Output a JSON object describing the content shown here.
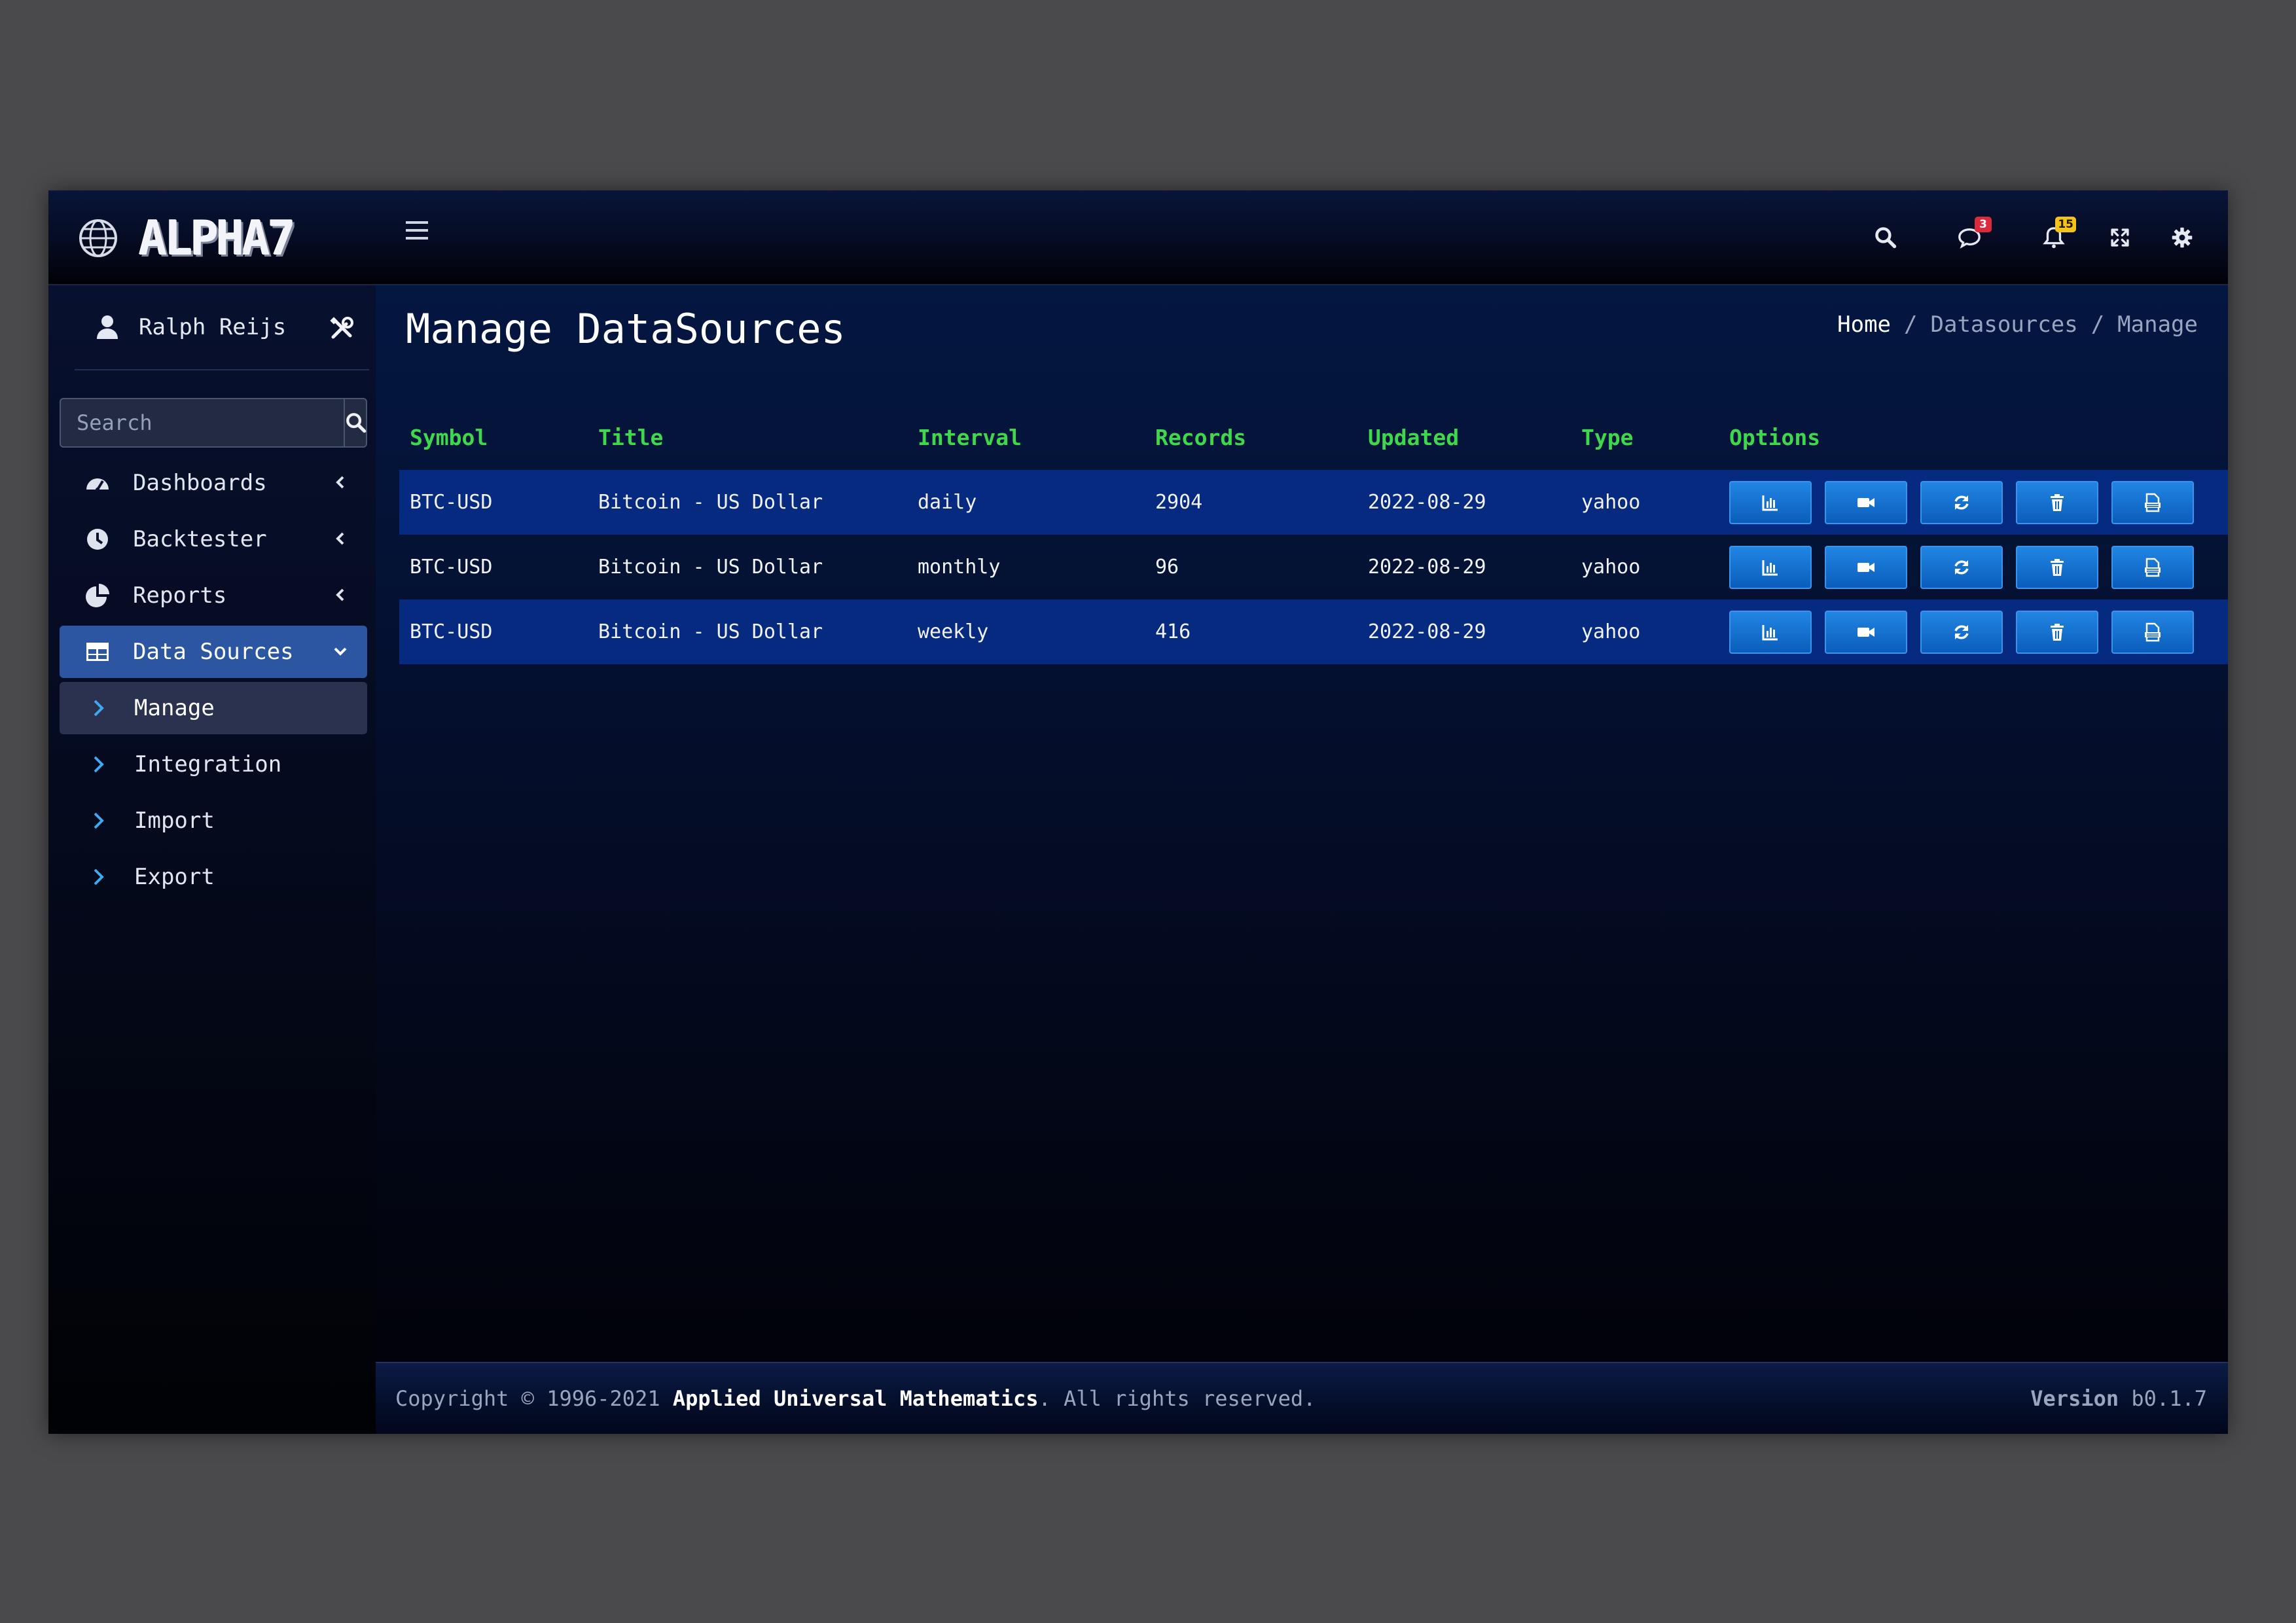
{
  "app": {
    "brand_name": "ALPHA7"
  },
  "topbar": {
    "icons": [
      "menu-icon",
      "search-icon",
      "chat-icon",
      "bell-icon",
      "fullscreen-icon",
      "gear-icon"
    ],
    "messages_badge": "3",
    "notifications_badge": "15"
  },
  "sidebar": {
    "user_name": "Ralph Reijs",
    "search_placeholder": "Search",
    "items": [
      {
        "label": "Dashboards",
        "icon": "gauge-icon"
      },
      {
        "label": "Backtester",
        "icon": "clock-icon"
      },
      {
        "label": "Reports",
        "icon": "pie-chart-icon"
      },
      {
        "label": "Data Sources",
        "icon": "table-icon"
      }
    ],
    "sub_items": [
      {
        "label": "Manage"
      },
      {
        "label": "Integration"
      },
      {
        "label": "Import"
      },
      {
        "label": "Export"
      }
    ]
  },
  "page": {
    "title": "Manage DataSources",
    "breadcrumb": [
      "Home",
      "Datasources",
      "Manage"
    ],
    "breadcrumb_sep": "/"
  },
  "table": {
    "headers": [
      "Symbol",
      "Title",
      "Interval",
      "Records",
      "Updated",
      "Type",
      "Options"
    ],
    "rows": [
      [
        "BTC-USD",
        "Bitcoin - US Dollar",
        "daily",
        "2904",
        "2022-08-29",
        "yahoo"
      ],
      [
        "BTC-USD",
        "Bitcoin - US Dollar",
        "monthly",
        "96",
        "2022-08-29",
        "yahoo"
      ],
      [
        "BTC-USD",
        "Bitcoin - US Dollar",
        "weekly",
        "416",
        "2022-08-29",
        "yahoo"
      ]
    ],
    "option_icons": [
      "bar-chart-icon",
      "video-icon",
      "refresh-icon",
      "trash-icon",
      "export-file-icon"
    ]
  },
  "footer": {
    "copyright_prefix": "Copyright © 1996-2021",
    "company": "Applied Universal Mathematics",
    "rights": ". All rights reserved.",
    "version_label": "Version",
    "version_value": "b0.1.7"
  },
  "colors": {
    "accent_green": "#3fd84c",
    "active_nav": "#2c55a2",
    "button_blue": "#1573d2",
    "badge_red": "#dc2a3c",
    "badge_yellow": "#f3c319"
  }
}
